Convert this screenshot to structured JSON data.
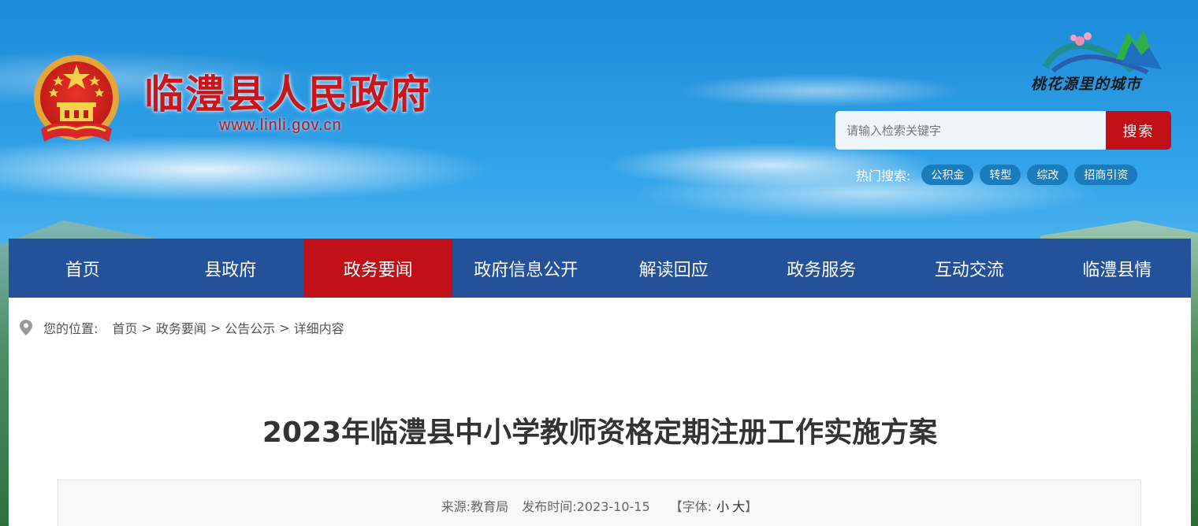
{
  "header": {
    "title": "临澧县人民政府",
    "url": "www.linli.gov.cn",
    "slogan": "桃花源里的城市"
  },
  "search": {
    "placeholder": "请输入检索关键字",
    "button_label": "搜索",
    "hot_label": "热门搜索:",
    "hot_tags": [
      "公积金",
      "转型",
      "综改",
      "招商引资"
    ]
  },
  "nav": {
    "items": [
      "首页",
      "县政府",
      "政务要闻",
      "政府信息公开",
      "解读回应",
      "政务服务",
      "互动交流",
      "临澧县情"
    ],
    "active": "政务要闻"
  },
  "breadcrumb": {
    "label": "您的位置:",
    "items": [
      "首页",
      "政务要闻",
      "公告公示",
      "详细内容"
    ],
    "separator": ">"
  },
  "article": {
    "title": "2023年临澧县中小学教师资格定期注册工作实施方案",
    "source": "来源:教育局",
    "publish_time": "发布时间:2023-10-15",
    "font_label": "【字体:",
    "font_small": "小",
    "font_large": "大",
    "font_close": "】"
  },
  "colors": {
    "brand_red": "#c00f16",
    "nav_blue": "#23519a",
    "tag_blue": "#1a7bbd"
  }
}
